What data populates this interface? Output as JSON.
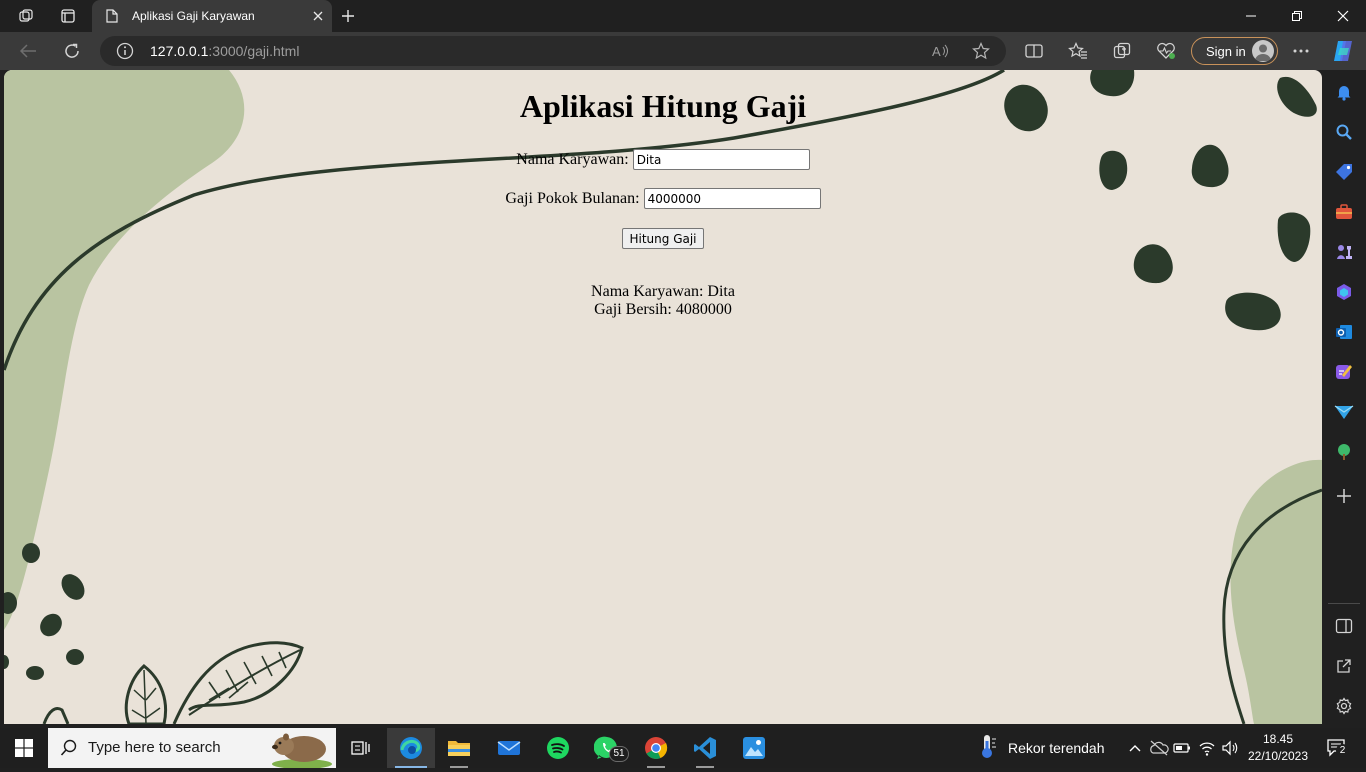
{
  "browser": {
    "tab_title": "Aplikasi Gaji Karyawan",
    "url_host": "127.0.0.1",
    "url_rest": ":3000/gaji.html",
    "signin_label": "Sign in"
  },
  "page": {
    "title": "Aplikasi Hitung Gaji",
    "name_label": "Nama Karyawan:",
    "name_value": "Dita",
    "salary_label": "Gaji Pokok Bulanan:",
    "salary_value": "4000000",
    "button_label": "Hitung Gaji",
    "result_name": "Nama Karyawan: Dita",
    "result_salary": "Gaji Bersih: 4080000"
  },
  "taskbar": {
    "search_placeholder": "Type here to search",
    "whatsapp_badge": "51",
    "weather_text": "Rekor terendah",
    "time": "18.45",
    "date": "22/10/2023",
    "notification_count": "2"
  },
  "colors": {
    "page_bg": "#e9e2d8",
    "leaf_dark": "#2b3a2b",
    "leaf_light": "#b9c4a1",
    "browser_frame": "#202020",
    "toolbar": "#3a3a3a"
  }
}
